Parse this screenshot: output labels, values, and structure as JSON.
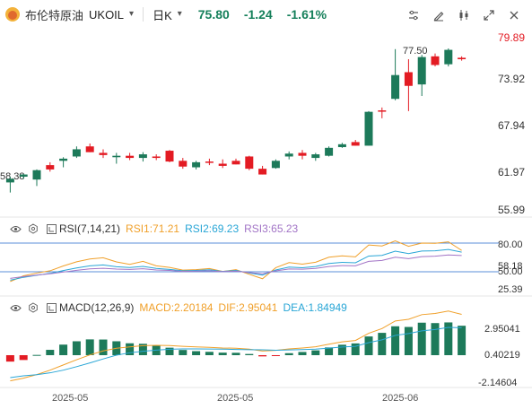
{
  "header": {
    "instrument_name": "布伦特原油",
    "symbol": "UKOIL",
    "timeframe": "日K",
    "last_price": "75.80",
    "change": "-1.24",
    "change_pct": "-1.61%"
  },
  "toolbar_icons": [
    "equalizer-icon",
    "draw-icon",
    "candlestick-type-icon",
    "fullscreen-icon",
    "close-icon"
  ],
  "main_chart": {
    "price_axis": [
      "79.89",
      "73.92",
      "67.94",
      "61.97",
      "55.99"
    ],
    "low_label": "58.38",
    "high_label": "77.50",
    "up_color": "#1d7a5a",
    "down_color": "#e31b23"
  },
  "rsi_panel": {
    "name": "RSI(7,14,21)",
    "rsi1_label": "RSI1:71.21",
    "rsi2_label": "RSI2:69.23",
    "rsi3_label": "RSI3:65.23",
    "axis": [
      "80.00",
      "50.00",
      "58.18",
      "25.39"
    ]
  },
  "macd_panel": {
    "name": "MACD(12,26,9)",
    "macd_label": "MACD:2.20184",
    "dif_label": "DIF:2.95041",
    "dea_label": "DEA:1.84949",
    "axis": [
      "2.95041",
      "0.40219",
      "-2.14604"
    ]
  },
  "x_axis_labels": [
    "2025-05",
    "2025-05",
    "2025-06"
  ],
  "chart_data": {
    "type": "candlestick",
    "price_range": [
      55.99,
      79.89
    ],
    "candles": [
      {
        "o": 59.8,
        "h": 60.6,
        "l": 58.4,
        "c": 60.3
      },
      {
        "o": 60.6,
        "h": 61.0,
        "l": 60.3,
        "c": 60.9
      },
      {
        "o": 60.2,
        "h": 61.6,
        "l": 59.3,
        "c": 61.5
      },
      {
        "o": 62.2,
        "h": 62.6,
        "l": 61.3,
        "c": 61.6
      },
      {
        "o": 62.8,
        "h": 63.3,
        "l": 61.9,
        "c": 63.1
      },
      {
        "o": 63.4,
        "h": 64.8,
        "l": 63.2,
        "c": 64.4
      },
      {
        "o": 64.8,
        "h": 65.2,
        "l": 64.0,
        "c": 64.0
      },
      {
        "o": 63.9,
        "h": 64.4,
        "l": 63.2,
        "c": 63.6
      },
      {
        "o": 63.3,
        "h": 63.9,
        "l": 62.4,
        "c": 63.5
      },
      {
        "o": 63.5,
        "h": 63.9,
        "l": 62.9,
        "c": 63.2
      },
      {
        "o": 63.2,
        "h": 64.0,
        "l": 62.7,
        "c": 63.7
      },
      {
        "o": 63.4,
        "h": 63.7,
        "l": 62.9,
        "c": 63.2
      },
      {
        "o": 64.2,
        "h": 64.3,
        "l": 62.6,
        "c": 62.7
      },
      {
        "o": 62.8,
        "h": 63.2,
        "l": 61.7,
        "c": 62.0
      },
      {
        "o": 61.9,
        "h": 62.8,
        "l": 61.6,
        "c": 62.6
      },
      {
        "o": 62.7,
        "h": 63.1,
        "l": 62.2,
        "c": 62.6
      },
      {
        "o": 62.4,
        "h": 63.0,
        "l": 61.8,
        "c": 62.1
      },
      {
        "o": 62.8,
        "h": 63.1,
        "l": 62.3,
        "c": 62.3
      },
      {
        "o": 63.4,
        "h": 63.5,
        "l": 61.5,
        "c": 61.7
      },
      {
        "o": 61.7,
        "h": 62.1,
        "l": 60.9,
        "c": 60.9
      },
      {
        "o": 61.8,
        "h": 63.0,
        "l": 61.7,
        "c": 62.8
      },
      {
        "o": 63.4,
        "h": 64.1,
        "l": 63.0,
        "c": 63.8
      },
      {
        "o": 63.9,
        "h": 64.3,
        "l": 63.0,
        "c": 63.5
      },
      {
        "o": 63.2,
        "h": 63.9,
        "l": 62.8,
        "c": 63.7
      },
      {
        "o": 63.5,
        "h": 64.8,
        "l": 63.4,
        "c": 64.6
      },
      {
        "o": 64.7,
        "h": 65.3,
        "l": 64.6,
        "c": 65.1
      },
      {
        "o": 65.4,
        "h": 65.7,
        "l": 64.9,
        "c": 64.9
      },
      {
        "o": 64.9,
        "h": 69.7,
        "l": 64.9,
        "c": 69.6
      },
      {
        "o": 69.8,
        "h": 70.2,
        "l": 68.7,
        "c": 69.7
      },
      {
        "o": 71.4,
        "h": 78.3,
        "l": 71.2,
        "c": 74.7
      },
      {
        "o": 75.1,
        "h": 76.9,
        "l": 69.7,
        "c": 73.2
      },
      {
        "o": 73.4,
        "h": 77.5,
        "l": 71.8,
        "c": 77.2
      },
      {
        "o": 77.3,
        "h": 77.7,
        "l": 75.9,
        "c": 76.1
      },
      {
        "o": 76.2,
        "h": 78.4,
        "l": 75.9,
        "c": 78.2
      },
      {
        "o": 77.1,
        "h": 77.3,
        "l": 76.7,
        "c": 76.9
      }
    ],
    "rsi": {
      "range": [
        25.39,
        80.0
      ],
      "rsi1": [
        34.1,
        40.9,
        44.2,
        46.9,
        52.7,
        57.6,
        61.0,
        62.4,
        57.5,
        54.6,
        58.2,
        52.8,
        50.9,
        47.8,
        48.3,
        49.6,
        46.1,
        48.3,
        42.7,
        37.4,
        50.6,
        56.7,
        54.8,
        57.1,
        63.1,
        64.7,
        63.6,
        77.7,
        76.5,
        82.6,
        76.2,
        80.0,
        79.7,
        81.5,
        71.2
      ],
      "rsi2": [
        35.7,
        39.1,
        41.6,
        43.8,
        47.2,
        50.3,
        52.8,
        53.9,
        51.8,
        50.8,
        52.1,
        49.7,
        48.6,
        46.9,
        47.4,
        48.1,
        46.2,
        47.4,
        44.3,
        41.8,
        47.9,
        51.4,
        50.6,
        52.0,
        55.6,
        57.0,
        56.5,
        64.5,
        65.3,
        70.3,
        67.4,
        70.5,
        70.8,
        72.4,
        69.2
      ],
      "rsi3": [
        37.8,
        40.0,
        41.8,
        43.3,
        45.4,
        47.5,
        49.2,
        49.9,
        49.0,
        48.5,
        49.3,
        47.9,
        47.3,
        46.2,
        46.5,
        47.0,
        45.9,
        46.6,
        44.8,
        43.3,
        46.8,
        49.1,
        48.8,
        49.7,
        52.0,
        53.1,
        52.8,
        58.2,
        59.3,
        63.1,
        61.4,
        63.8,
        64.3,
        65.8,
        65.2
      ]
    },
    "macd": {
      "range": [
        -2.14604,
        2.95041
      ],
      "hist": [
        -0.48,
        -0.36,
        0.02,
        0.4,
        0.79,
        1.04,
        1.18,
        1.17,
        1.04,
        0.89,
        0.85,
        0.72,
        0.56,
        0.39,
        0.3,
        0.25,
        0.19,
        0.18,
        0.09,
        -0.09,
        -0.01,
        0.15,
        0.24,
        0.36,
        0.58,
        0.78,
        0.88,
        1.4,
        1.67,
        2.16,
        2.11,
        2.43,
        2.4,
        2.45,
        2.2
      ],
      "dif": [
        -1.92,
        -1.72,
        -1.45,
        -1.12,
        -0.73,
        -0.34,
        0.02,
        0.32,
        0.52,
        0.62,
        0.71,
        0.74,
        0.72,
        0.66,
        0.62,
        0.59,
        0.54,
        0.52,
        0.45,
        0.31,
        0.36,
        0.47,
        0.54,
        0.63,
        0.82,
        1.0,
        1.1,
        1.64,
        1.99,
        2.56,
        2.68,
        3.03,
        3.12,
        3.3,
        3.05
      ],
      "dea": [
        -1.68,
        -1.54,
        -1.46,
        -1.32,
        -1.12,
        -0.86,
        -0.58,
        -0.28,
        0.0,
        0.18,
        0.29,
        0.38,
        0.44,
        0.47,
        0.47,
        0.46,
        0.45,
        0.43,
        0.41,
        0.4,
        0.37,
        0.39,
        0.42,
        0.45,
        0.53,
        0.61,
        0.66,
        0.94,
        1.15,
        1.48,
        1.62,
        1.82,
        1.92,
        2.08,
        2.05
      ]
    }
  }
}
